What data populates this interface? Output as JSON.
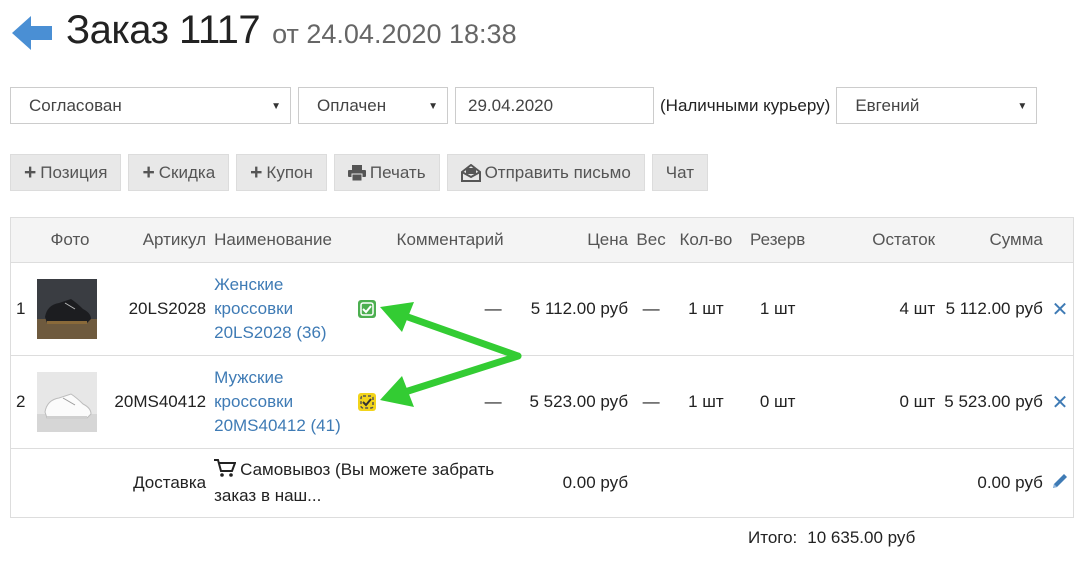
{
  "header": {
    "title": "Заказ 1117",
    "subtitle": "от 24.04.2020 18:38"
  },
  "filters": {
    "status": "Согласован",
    "payment_status": "Оплачен",
    "delivery_date": "29.04.2020",
    "payment_method": "(Наличными курьеру)",
    "courier": "Евгений"
  },
  "toolbar": {
    "add_position": "Позиция",
    "add_discount": "Скидка",
    "add_coupon": "Купон",
    "print": "Печать",
    "send_email": "Отправить письмо",
    "chat": "Чат"
  },
  "table": {
    "headers": {
      "photo": "Фото",
      "sku": "Артикул",
      "name": "Наименование",
      "comment": "Комментарий",
      "price": "Цена",
      "weight": "Вес",
      "qty": "Кол-во",
      "reserve": "Резерв",
      "stock": "Остаток",
      "sum": "Сумма"
    },
    "rows": [
      {
        "num": "1",
        "sku": "20LS2028",
        "name_lines": [
          "Женские",
          "кроссовки",
          "20LS2028 (36)"
        ],
        "comment_icon": "check-badge-green-icon",
        "comment": "—",
        "price": "5 112.00 руб",
        "weight": "—",
        "qty": "1 шт",
        "reserve": "1 шт",
        "stock": "4 шт",
        "sum": "5 112.00 руб"
      },
      {
        "num": "2",
        "sku": "20MS40412",
        "name_lines": [
          "Мужские",
          "кроссовки",
          "20MS40412 (41)"
        ],
        "comment_icon": "check-badge-yellow-icon",
        "comment": "—",
        "price": "5 523.00 руб",
        "weight": "—",
        "qty": "1 шт",
        "reserve": "0 шт",
        "stock": "0 шт",
        "sum": "5 523.00 руб"
      }
    ],
    "delivery": {
      "label": "Доставка",
      "text_line1": "Самовывоз (Вы можете забрать",
      "text_line2": "заказ в наш...",
      "price": "0.00 руб",
      "sum": "0.00 руб"
    }
  },
  "total": {
    "label": "Итого:",
    "value": "10 635.00 руб"
  },
  "colors": {
    "link": "#3f7bb5",
    "back_arrow": "#4a8fd4",
    "green_badge": "#4caf50",
    "yellow_badge": "#f2d41b",
    "annotation_arrow": "#33cc33"
  }
}
